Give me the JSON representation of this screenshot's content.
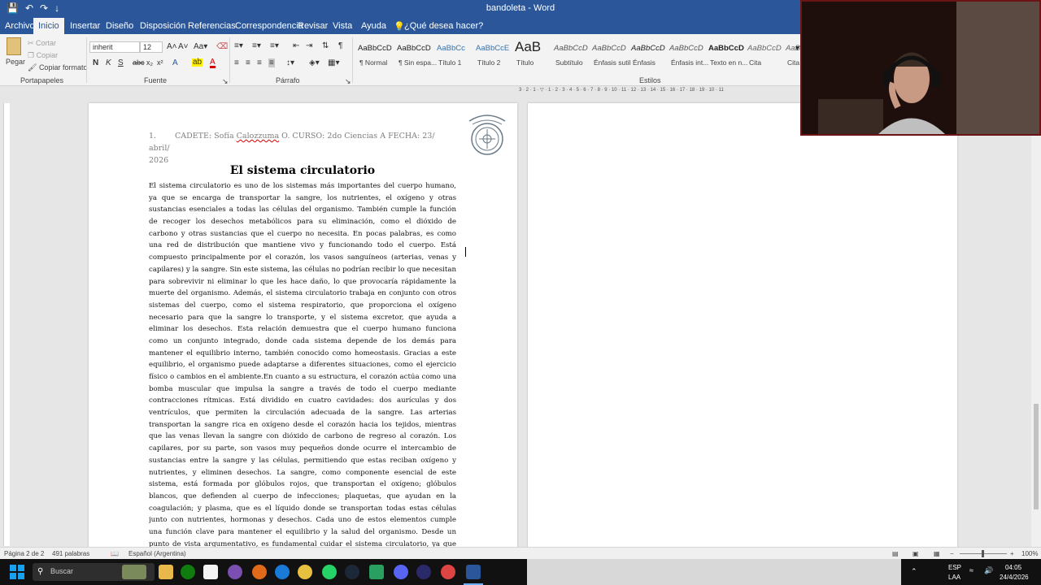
{
  "window": {
    "title": "bandoleta - Word"
  },
  "tabs": [
    {
      "label": "Archivo",
      "active": false
    },
    {
      "label": "Inicio",
      "active": true
    },
    {
      "label": "Insertar",
      "active": false
    },
    {
      "label": "Diseño",
      "active": false
    },
    {
      "label": "Disposición",
      "active": false
    },
    {
      "label": "Referencias",
      "active": false
    },
    {
      "label": "Correspondencia",
      "active": false
    },
    {
      "label": "Revisar",
      "active": false
    },
    {
      "label": "Vista",
      "active": false
    },
    {
      "label": "Ayuda",
      "active": false
    },
    {
      "label": "¿Qué desea hacer?",
      "active": false
    }
  ],
  "ribbon": {
    "clipboard": {
      "paste": "Pegar",
      "cut": "Cortar",
      "copy": "Copiar",
      "format_painter": "Copiar formato",
      "label": "Portapapeles"
    },
    "font": {
      "family": "inherit",
      "size": "12",
      "label": "Fuente"
    },
    "paragraph": {
      "label": "Párrafo"
    },
    "styles": {
      "label": "Estilos",
      "items": [
        {
          "preview": "AaBbCcD",
          "name": "¶ Normal"
        },
        {
          "preview": "AaBbCcD",
          "name": "¶ Sin espa..."
        },
        {
          "preview": "AaBbCc",
          "name": "Título 1"
        },
        {
          "preview": "AaBbCcE",
          "name": "Título 2"
        },
        {
          "preview": "AaB",
          "name": "Título"
        },
        {
          "preview": "AaBbCcD",
          "name": "Subtítulo"
        },
        {
          "preview": "AaBbCcD",
          "name": "Énfasis sutil"
        },
        {
          "preview": "AaBbCcD",
          "name": "Énfasis"
        },
        {
          "preview": "AaBbCcD",
          "name": "Énfasis int..."
        },
        {
          "preview": "AaBbCcD",
          "name": "Texto en n..."
        },
        {
          "preview": "AaBbCcD",
          "name": "Cita"
        },
        {
          "preview": "AaBbC",
          "name": "Cita"
        }
      ]
    }
  },
  "document": {
    "header_number": "1.",
    "header_line1": "CADETE: Sofía Calozzuma O. CURSO: 2do Ciencias A FECHA: 23/ abril/",
    "header_line2": "2026",
    "title": "El sistema circulatorio",
    "lines": [
      "El sistema circulatorio es uno de los sistemas más importantes del cuerpo humano,",
      "ya que se encarga de transportar la sangre, los nutrientes, el oxígeno y otras",
      "sustancias esenciales a todas las células del organismo. También cumple la función",
      "de recoger los desechos metabólicos para su eliminación, como el dióxido de",
      "carbono y otras sustancias que el cuerpo no necesita. En pocas palabras, es como",
      "una red de distribución que mantiene vivo y funcionando todo el cuerpo. Está",
      "compuesto principalmente por el corazón, los vasos sanguíneos (arterias, venas y",
      "capilares) y la sangre. Sin este sistema, las células no podrían recibir lo que necesitan",
      "para sobrevivir ni eliminar lo que les hace daño, lo que provocaría rápidamente la",
      "muerte del organismo. Además, el sistema circulatorio trabaja en conjunto con otros",
      "sistemas del cuerpo, como el sistema respiratorio, que proporciona el oxígeno",
      "necesario para que la sangre lo transporte, y el sistema excretor, que ayuda a",
      "eliminar los desechos. Esta relación demuestra que el cuerpo humano funciona",
      "como un conjunto integrado, donde cada sistema depende de los demás para",
      "mantener el equilibrio interno, también conocido como homeostasis. Gracias a este",
      "equilibrio, el organismo puede adaptarse a diferentes situaciones, como el ejercicio",
      "físico o cambios en el ambiente.En cuanto a su estructura, el corazón actúa como una",
      "bomba muscular que impulsa la sangre a través de todo el cuerpo mediante",
      "contracciones rítmicas. Está dividido en cuatro cavidades: dos aurículas y dos",
      "ventrículos, que permiten la circulación adecuada de la sangre. Las arterias",
      "transportan la sangre rica en oxígeno desde el corazón hacia los tejidos, mientras",
      "que las venas llevan la sangre con dióxido de carbono de regreso al corazón. Los",
      "capilares, por su parte, son vasos muy pequeños donde ocurre el intercambio de",
      "sustancias entre la sangre y las células, permitiendo que estas reciban oxígeno y",
      "nutrientes, y eliminen desechos. La sangre, como componente esencial de este",
      "sistema, está formada por glóbulos rojos, que transportan el oxígeno; glóbulos",
      "blancos, que defienden al cuerpo de infecciones; plaquetas, que ayudan en la",
      "coagulación; y plasma, que es el líquido donde se transportan todas estas células",
      "junto con nutrientes, hormonas y desechos. Cada uno de estos elementos cumple",
      "una función clave para mantener el equilibrio y la salud del organismo. Desde un",
      "punto de vista argumentativo, es fundamental cuidar el sistema circulatorio, ya que"
    ]
  },
  "statusbar": {
    "page": "Página 2 de 2",
    "words": "491 palabras",
    "language": "Español (Argentina)",
    "zoom": "100%"
  },
  "taskbar": {
    "search_placeholder": "Buscar",
    "lang": "ESP",
    "lang2": "LAA",
    "time": "04:05",
    "date": "24/4/2026"
  },
  "colors": {
    "word_blue": "#2b579a",
    "taskbar": "#111111"
  }
}
